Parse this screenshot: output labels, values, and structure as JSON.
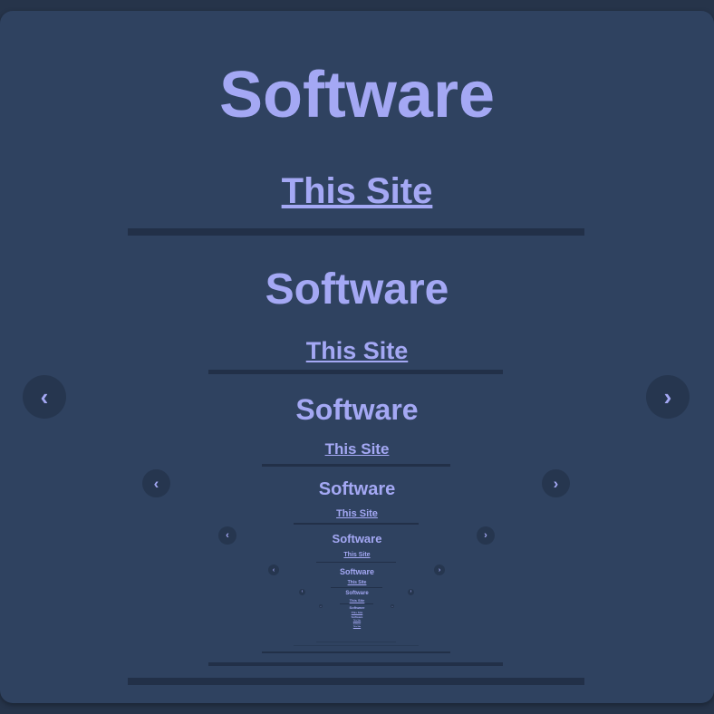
{
  "slide": {
    "title": "Software",
    "link_label": "This Site",
    "prev_icon": "‹",
    "next_icon": "›"
  },
  "colors": {
    "background": "#26344a",
    "panel": "#2f4260",
    "accent": "#a4a8f4",
    "divider": "#223048",
    "nav_button": "#26364f"
  },
  "icons": {
    "prev": "chevron-left-icon",
    "next": "chevron-right-icon"
  }
}
